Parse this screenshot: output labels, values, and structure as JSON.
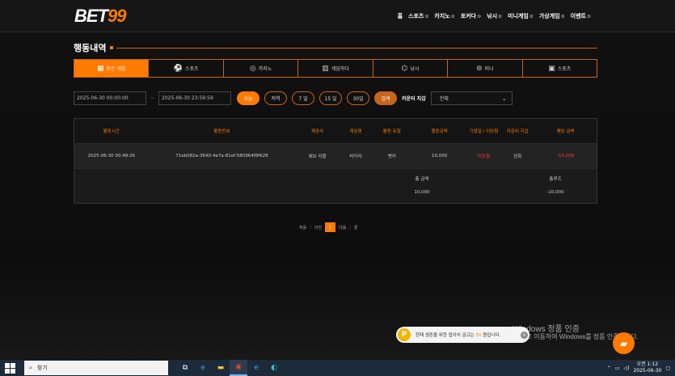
{
  "header": {
    "logo_left": "BET",
    "logo_right": "99",
    "nav": [
      "홈",
      "스포츠",
      "카지노",
      "포커다",
      "낚시",
      "미니게임",
      "가상게임",
      "이벤트"
    ]
  },
  "page_title": "행동내역",
  "tabs": [
    {
      "label": "모든 게임",
      "icon": "grid-icon"
    },
    {
      "label": "스포츠",
      "icon": "soccer-icon"
    },
    {
      "label": "카지노",
      "icon": "chip-icon"
    },
    {
      "label": "게임하다",
      "icon": "slot-icon"
    },
    {
      "label": "낚시",
      "icon": "fish-icon"
    },
    {
      "label": "미니",
      "icon": "gamepad-icon"
    },
    {
      "label": "스포츠",
      "icon": "ticket-icon"
    }
  ],
  "filters": {
    "date_from": "2025-06-30 00:00:00",
    "separator": "~",
    "date_to": "2025-06-30 23:59:59",
    "quick": [
      "오늘",
      "저역",
      "7 일",
      "15 일",
      "30일"
    ],
    "search_label": "검색",
    "counter_label": "카운터 지갑",
    "select_value": "전체"
  },
  "table": {
    "headers": [
      "활동시간",
      "활동번호",
      "제공사",
      "게임명",
      "활동 유형",
      "행동금액",
      "기념일 / 이당첨",
      "카운터 지갑",
      "해당 금액"
    ],
    "rows": [
      [
        "2025-06-30 00:48:26",
        "71eb082a-3640-4e7a-81ef-580964f8f628",
        "에보 리볼",
        "바카라",
        "벳커",
        "10,000",
        "미당첨",
        "완화",
        "-10,000"
      ]
    ],
    "summary": {
      "total_label": "총 금액",
      "total_value": "10,000",
      "profit_label": "총루즈",
      "profit_value": "-10,000"
    }
  },
  "pager": {
    "first": "처음",
    "prev": "이전",
    "current": "1",
    "next": "다음",
    "last": "끝"
  },
  "watermark": {
    "line1": "Windows 정품 인증",
    "line2": "[설정]으로 이동하여 Windows를 정품 인증합니다."
  },
  "toast": {
    "coin": "P",
    "text_before": "현재 생존을 위한 접이식 금고는 ",
    "highlight": "50",
    "text_after": " 원입니다."
  },
  "taskbar": {
    "search_placeholder": "찾기",
    "time": "오전 1:12",
    "date": "2025-06-30"
  },
  "colors": {
    "accent": "#ff7a00",
    "negative": "#ff3b30"
  }
}
